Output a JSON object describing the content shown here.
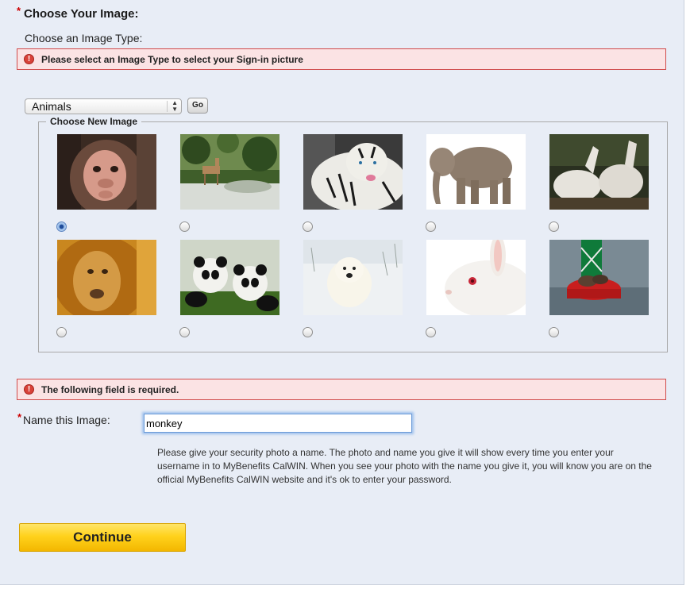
{
  "section": {
    "required_mark": "*",
    "heading": "Choose Your Image:",
    "type_label": "Choose an Image Type:"
  },
  "errors": {
    "select_type": "Please select an Image Type to select your Sign-in picture",
    "field_required": "The following field is required."
  },
  "image_type": {
    "selected": "Animals",
    "go_label": "Go"
  },
  "gallery": {
    "legend": "Choose New Image",
    "selected_index": 0,
    "images": [
      {
        "name": "monkey-image"
      },
      {
        "name": "deer-image"
      },
      {
        "name": "white-tiger-image"
      },
      {
        "name": "elephant-image"
      },
      {
        "name": "white-horses-image"
      },
      {
        "name": "lion-image"
      },
      {
        "name": "pandas-image"
      },
      {
        "name": "polar-bear-image"
      },
      {
        "name": "white-rabbit-image"
      },
      {
        "name": "sea-lion-buoy-image"
      }
    ]
  },
  "name_field": {
    "required_mark": "*",
    "label": "Name this Image:",
    "value": "monkey"
  },
  "help_text": "Please give your security photo a name. The photo and name you give it will show every time you enter your username in to MyBenefits CalWIN. When you see your photo with the name you give it, you will know you are on the official MyBenefits CalWIN website and it's ok to enter your password.",
  "continue_label": "Continue"
}
